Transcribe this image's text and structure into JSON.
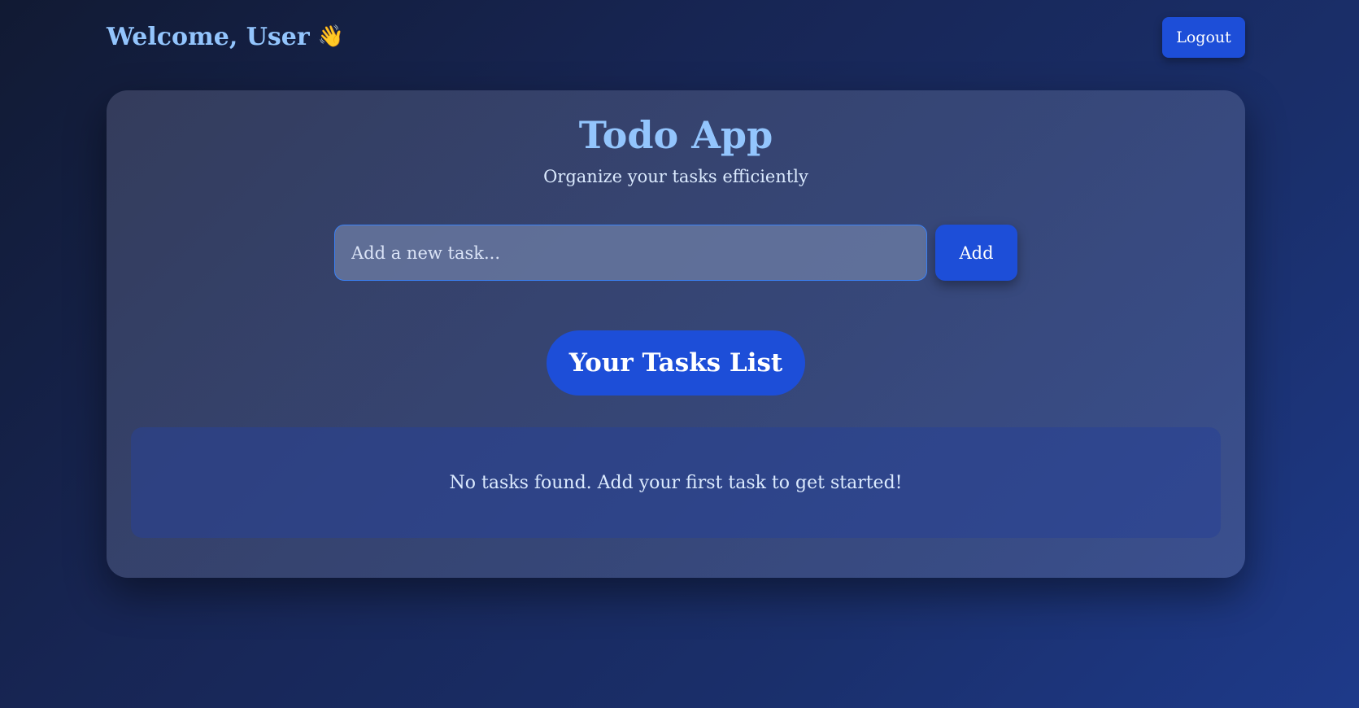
{
  "header": {
    "welcome_text": "Welcome, User",
    "wave_emoji": "👋",
    "logout_label": "Logout"
  },
  "app": {
    "title": "Todo App",
    "subtitle": "Organize your tasks efficiently",
    "task_input": {
      "placeholder": "Add a new task...",
      "value": ""
    },
    "add_label": "Add",
    "list_heading": "Your Tasks List",
    "empty_message": "No tasks found. Add your first task to get started!"
  },
  "colors": {
    "accent": "#1d4ed8",
    "heading": "#93c5fd",
    "background_dark": "#111a33",
    "background_light": "#1e3a8a"
  }
}
